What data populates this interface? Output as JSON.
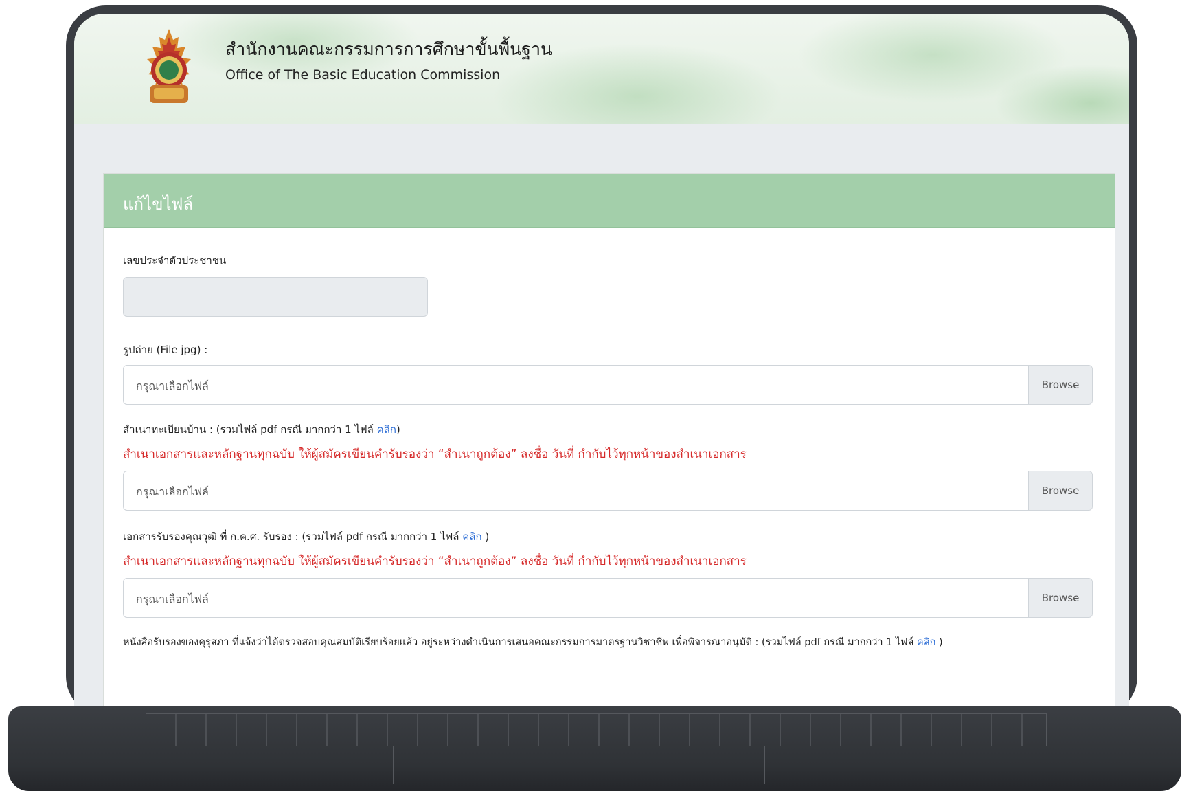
{
  "header": {
    "org_name_th": "สำนักงานคณะกรรมการการศึกษาขั้นพื้นฐาน",
    "org_name_en": "Office of The Basic Education Commission"
  },
  "form": {
    "title": "แก้ไขไฟล์",
    "id_card": {
      "label": "เลขประจำตัวประชาชน",
      "value": ""
    },
    "photo": {
      "label": "รูปถ่าย (File jpg) :",
      "placeholder": "กรุณาเลือกไฟล์",
      "browse": "Browse"
    },
    "house_registration": {
      "label": "สำเนาทะเบียนบ้าน : (รวมไฟล์ pdf กรณี มากกว่า 1 ไฟล์",
      "link": "คลิก",
      "label_end": ")",
      "warning": "สำเนาเอกสารและหลักฐานทุกฉบับ ให้ผู้สมัครเขียนคำรับรองว่า “สำเนาถูกต้อง” ลงชื่อ วันที่ กำกับไว้ทุกหน้าของสำเนาเอกสาร",
      "placeholder": "กรุณาเลือกไฟล์",
      "browse": "Browse"
    },
    "qualification": {
      "label": "เอกสารรับรองคุณวุฒิ ที่ ก.ค.ศ. รับรอง : (รวมไฟล์ pdf กรณี มากกว่า 1 ไฟล์",
      "link": "คลิก",
      "label_end": " )",
      "warning": "สำเนาเอกสารและหลักฐานทุกฉบับ ให้ผู้สมัครเขียนคำรับรองว่า “สำเนาถูกต้อง” ลงชื่อ วันที่ กำกับไว้ทุกหน้าของสำเนาเอกสาร",
      "placeholder": "กรุณาเลือกไฟล์",
      "browse": "Browse"
    },
    "kurusapha": {
      "label": "หนังสือรับรองของคุรุสภา ที่แจ้งว่าได้ตรวจสอบคุณสมบัติเรียบร้อยแล้ว อยู่ระหว่างดำเนินการเสนอคณะกรรมการมาตรฐานวิชาชีพ เพื่อพิจารณาอนุมัติ : (รวมไฟล์ pdf กรณี มากกว่า 1 ไฟล์",
      "link": "คลิก",
      "label_end": " )"
    }
  },
  "colors": {
    "card_header": "#a3cfaa",
    "warning_text": "#d62b2b",
    "link": "#2f6fd6",
    "bezel": "#3a3d42"
  }
}
